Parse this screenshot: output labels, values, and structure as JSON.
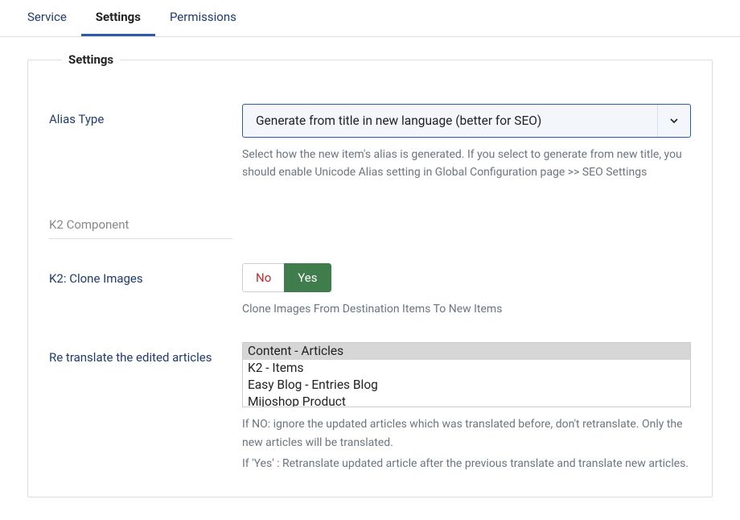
{
  "tabs": {
    "service": "Service",
    "settings": "Settings",
    "permissions": "Permissions"
  },
  "fieldset": {
    "legend": "Settings"
  },
  "aliasType": {
    "label": "Alias Type",
    "value": "Generate from title in new language (better for SEO)",
    "help": "Select how the new item's alias is generated. If you select to generate from new title, you should enable Unicode Alias setting in Global Configuration page >> SEO Settings"
  },
  "k2Section": {
    "title": "K2 Component"
  },
  "cloneImages": {
    "label": "K2: Clone Images",
    "noLabel": "No",
    "yesLabel": "Yes",
    "help": "Clone Images From Destination Items To New Items"
  },
  "retranslate": {
    "label": "Re translate the edited articles",
    "options": [
      "Content - Articles",
      "K2 - Items",
      "Easy Blog - Entries Blog",
      "Mijoshop Product"
    ],
    "help1": "If NO: ignore the updated articles which was translated before, don't retranslate. Only the new articles will be translated.",
    "help2": "If 'Yes' : Retranslate updated article after the previous translate and translate new articles."
  }
}
